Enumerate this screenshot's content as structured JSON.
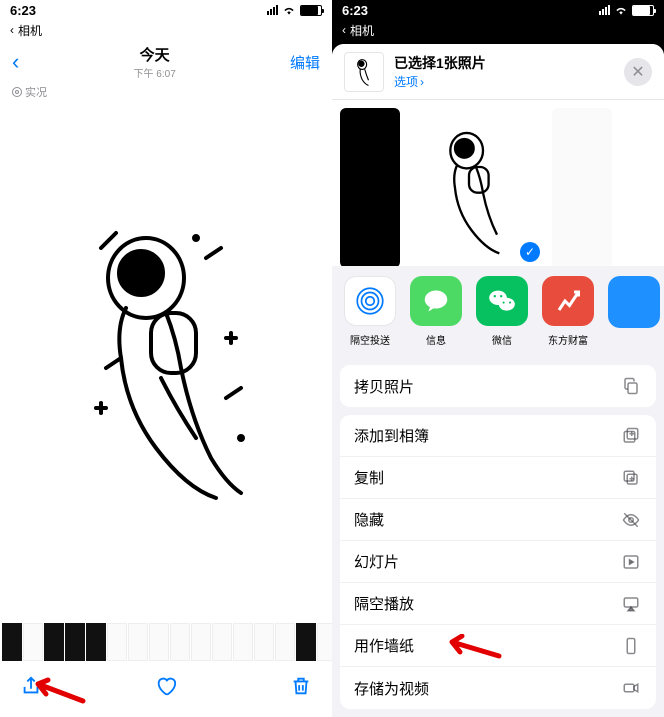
{
  "status": {
    "time": "6:23"
  },
  "left": {
    "back_label": "相机",
    "nav": {
      "title": "今天",
      "subtitle": "下午 6:07",
      "edit": "编辑"
    },
    "live": "实况"
  },
  "right": {
    "back_label": "相机",
    "sheet": {
      "title": "已选择1张照片",
      "options": "选项"
    },
    "apps": [
      {
        "key": "airdrop",
        "label": "隔空投送"
      },
      {
        "key": "msg",
        "label": "信息"
      },
      {
        "key": "wechat",
        "label": "微信"
      },
      {
        "key": "east",
        "label": "东方财富"
      },
      {
        "key": "blue",
        "label": ""
      }
    ],
    "group1": [
      {
        "key": "copy-photo",
        "label": "拷贝照片",
        "icon": "copy"
      }
    ],
    "group2": [
      {
        "key": "add-album",
        "label": "添加到相簿",
        "icon": "album"
      },
      {
        "key": "duplicate",
        "label": "复制",
        "icon": "dup"
      },
      {
        "key": "hide",
        "label": "隐藏",
        "icon": "eye-off"
      },
      {
        "key": "slideshow",
        "label": "幻灯片",
        "icon": "play"
      },
      {
        "key": "airplay",
        "label": "隔空播放",
        "icon": "airplay"
      },
      {
        "key": "wallpaper",
        "label": "用作墙纸",
        "icon": "phone"
      },
      {
        "key": "save-video",
        "label": "存储为视频",
        "icon": "video"
      }
    ]
  }
}
